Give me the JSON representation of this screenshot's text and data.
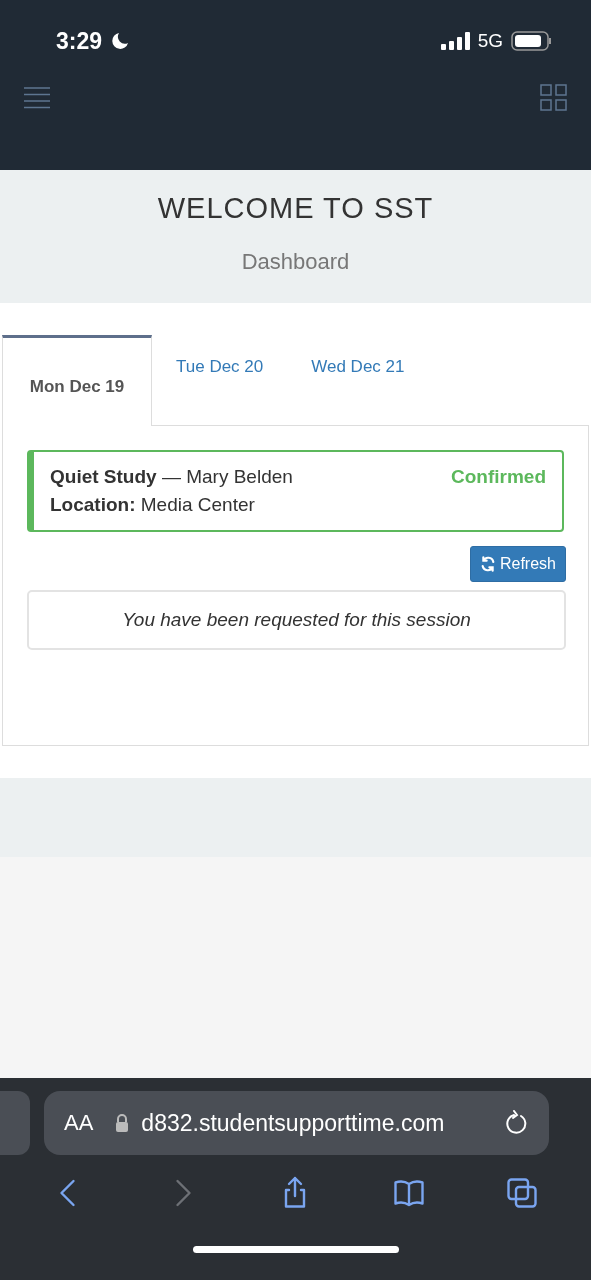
{
  "status_bar": {
    "time": "3:29",
    "network": "5G"
  },
  "header": {
    "title": "WELCOME TO SST",
    "subtitle": "Dashboard"
  },
  "tabs": [
    {
      "label": "Mon Dec 19",
      "selected": true
    },
    {
      "label": "Tue Dec 20",
      "selected": false
    },
    {
      "label": "Wed Dec 21",
      "selected": false
    }
  ],
  "session": {
    "heading": "**Quiet Study** — Mary Belden",
    "location": "**Location:** Media Center",
    "status": "Confirmed",
    "color": "#5cb85c"
  },
  "refresh_button": "Refresh",
  "message": "You have been requested for this session",
  "browser": {
    "text_size": "AA",
    "url": "d832.studentsupporttime.com",
    "nav": [
      {
        "kind": "back",
        "disabled": false
      },
      {
        "kind": "forward",
        "disabled": true
      },
      {
        "kind": "share",
        "disabled": false
      },
      {
        "kind": "bookmarks",
        "disabled": false
      },
      {
        "kind": "tabs",
        "disabled": false
      }
    ]
  }
}
